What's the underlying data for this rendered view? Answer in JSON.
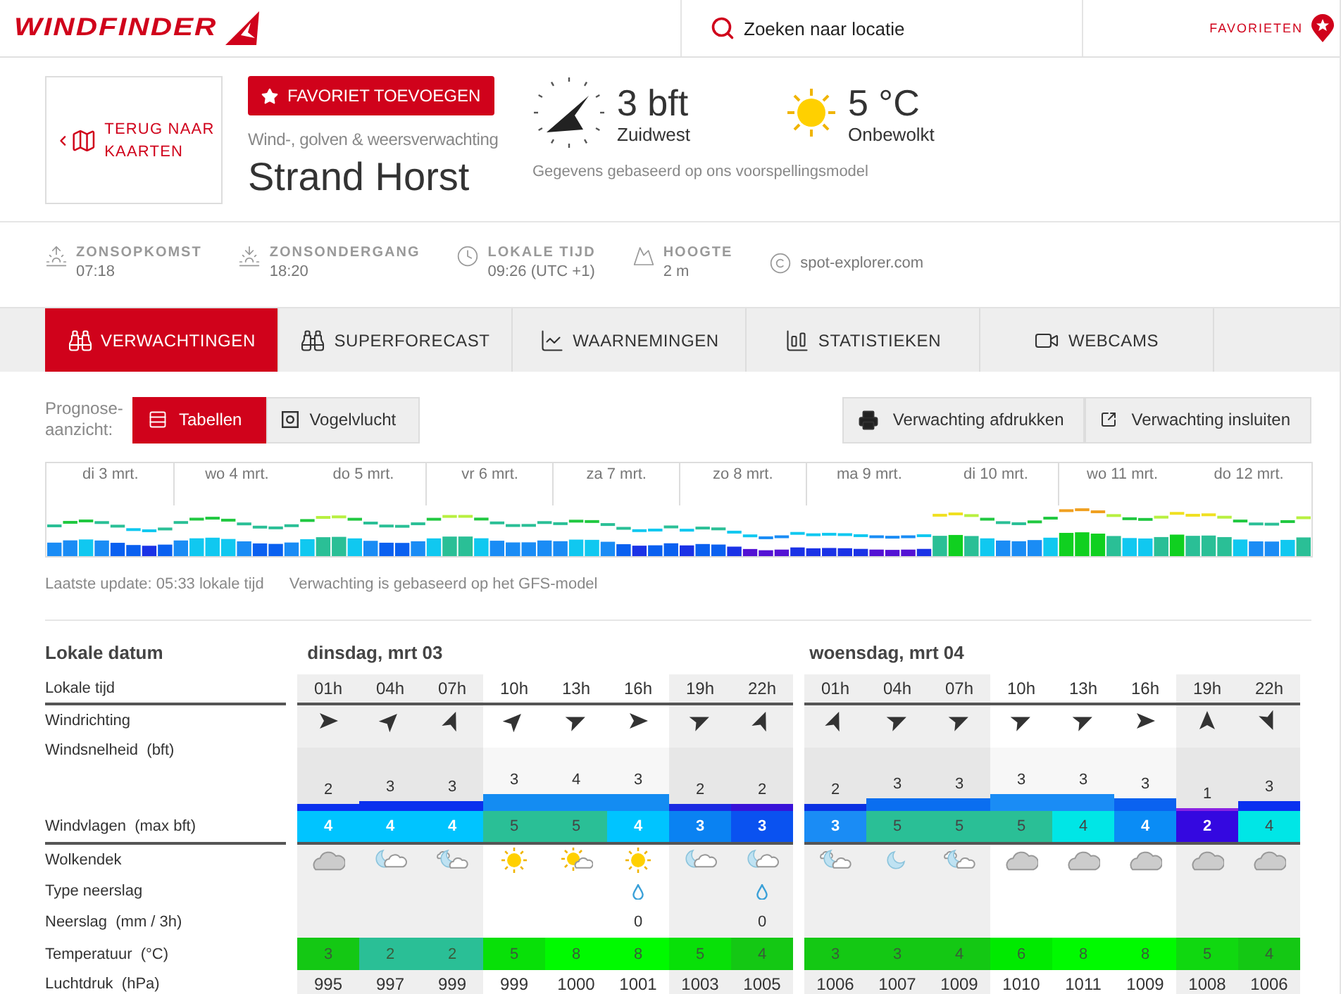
{
  "header": {
    "logo": "WINDFINDER",
    "search": {
      "placeholder": "Zoeken naar locatie"
    },
    "favorites_link": "FAVORIETEN"
  },
  "spot": {
    "back_link": "TERUG NAAR KAARTEN",
    "favorite_button": "FAVORIET TOEVOEGEN",
    "subtitle": "Wind-, golven & weersverwachting",
    "name": "Strand Horst",
    "wind": {
      "value": "3 bft",
      "direction": "Zuidwest"
    },
    "weather": {
      "value": "5 °C",
      "condition": "Onbewolkt"
    },
    "note": "Gegevens gebaseerd op ons voorspellingsmodel"
  },
  "facts": [
    {
      "kind": "sunrise",
      "label": "ZONSOPKOMST",
      "value": "07:18"
    },
    {
      "kind": "sunset",
      "label": "ZONSONDERGANG",
      "value": "18:20"
    },
    {
      "kind": "clock",
      "label": "LOKALE TIJD",
      "value": "09:26 (UTC +1)"
    },
    {
      "kind": "altitude",
      "label": "HOOGTE",
      "value": "2 m"
    },
    {
      "kind": "source",
      "value": "spot-explorer.com"
    }
  ],
  "tabs": [
    {
      "kind": "forecast",
      "label": "VERWACHTINGEN",
      "selected": true
    },
    {
      "kind": "superforecast",
      "label": "SUPERFORECAST",
      "selected": false
    },
    {
      "kind": "observations",
      "label": "WAARNEMINGEN",
      "selected": false
    },
    {
      "kind": "statistics",
      "label": "STATISTIEKEN",
      "selected": false
    },
    {
      "kind": "webcams",
      "label": "WEBCAMS",
      "selected": false
    }
  ],
  "view_switch": {
    "label": "Prognose-aanzicht:",
    "options": [
      {
        "kind": "tables",
        "label": "Tabellen",
        "selected": true
      },
      {
        "kind": "aerial",
        "label": "Vogelvlucht",
        "selected": false
      }
    ]
  },
  "actions": [
    {
      "kind": "print",
      "label": "Verwachting afdrukken"
    },
    {
      "kind": "embed",
      "label": "Verwachting insluiten"
    }
  ],
  "overview": {
    "days": [
      "di 3 mrt.",
      "wo 4 mrt.",
      "do 5 mrt.",
      "vr 6 mrt.",
      "za 7 mrt.",
      "zo 8 mrt.",
      "ma 9 mrt.",
      "di 10 mrt.",
      "wo 11 mrt.",
      "do 12 mrt."
    ]
  },
  "update_info": [
    "Laatste update: 05:33 lokale tijd",
    "Verwachting is gebaseerd op het GFS-model"
  ],
  "table": {
    "date_label": "Lokale datum",
    "rows": [
      {
        "kind": "time",
        "label": "Lokale tijd"
      },
      {
        "kind": "direction",
        "label": "Windrichting"
      },
      {
        "kind": "speed",
        "label": "Windsnelheid  (bft)"
      },
      {
        "kind": "gust",
        "label": "Windvlagen  (max bft)"
      },
      {
        "kind": "cloud",
        "label": "Wolkendek"
      },
      {
        "kind": "precip_type",
        "label": "Type neerslag"
      },
      {
        "kind": "precip",
        "label": "Neerslag  (mm / 3h)"
      },
      {
        "kind": "temp",
        "label": "Temperatuur  (°C)"
      },
      {
        "kind": "pressure",
        "label": "Luchtdruk  (hPa)"
      }
    ],
    "days": [
      {
        "date": "dinsdag, mrt 03",
        "hours": [
          {
            "time": "01h",
            "night": true,
            "arrow": {
              "kind": "E"
            },
            "speed": {
              "value": "2",
              "level": 0.11,
              "color": "#0a30ee"
            },
            "gust": {
              "value": "4",
              "color": "#00c4ff"
            },
            "sky": {
              "kind": "overcast"
            },
            "temp": {
              "value": "3",
              "color": "#14c814"
            },
            "pressure": "995"
          },
          {
            "time": "04h",
            "night": true,
            "arrow": {
              "kind": "NE"
            },
            "speed": {
              "value": "3",
              "level": 0.16,
              "color": "#0a30ee"
            },
            "gust": {
              "value": "4",
              "color": "#00c4ff"
            },
            "sky": {
              "kind": "moon-cloud"
            },
            "temp": {
              "value": "2",
              "color": "#2abf96"
            },
            "pressure": "997"
          },
          {
            "time": "07h",
            "night": true,
            "arrow": {
              "kind": "NNE"
            },
            "speed": {
              "value": "3",
              "level": 0.16,
              "color": "#0a30ee"
            },
            "gust": {
              "value": "4",
              "color": "#00c4ff"
            },
            "sky": {
              "kind": "moon-clouds"
            },
            "temp": {
              "value": "2",
              "color": "#2abf96"
            },
            "pressure": "999"
          },
          {
            "time": "10h",
            "night": false,
            "arrow": {
              "kind": "NE"
            },
            "speed": {
              "value": "3",
              "level": 0.27,
              "color": "#148cf2"
            },
            "gust": {
              "value": "5",
              "color": "#2abf96"
            },
            "sky": {
              "kind": "sun"
            },
            "temp": {
              "value": "5",
              "color": "#08e008"
            },
            "pressure": "999"
          },
          {
            "time": "13h",
            "night": false,
            "arrow": {
              "kind": "ENE"
            },
            "speed": {
              "value": "4",
              "level": 0.27,
              "color": "#148cf2"
            },
            "gust": {
              "value": "5",
              "color": "#2abf96"
            },
            "sky": {
              "kind": "sun-cloud"
            },
            "temp": {
              "value": "8",
              "color": "#00fa00"
            },
            "pressure": "1000"
          },
          {
            "time": "16h",
            "night": false,
            "arrow": {
              "kind": "E"
            },
            "speed": {
              "value": "3",
              "level": 0.27,
              "color": "#148cf2"
            },
            "gust": {
              "value": "4",
              "color": "#00c4ff"
            },
            "sky": {
              "kind": "sun"
            },
            "precip": {
              "kind": "rain",
              "value": "0"
            },
            "temp": {
              "value": "8",
              "color": "#00fa00"
            },
            "pressure": "1001"
          },
          {
            "time": "19h",
            "night": true,
            "arrow": {
              "kind": "ENE"
            },
            "speed": {
              "value": "2",
              "level": 0.11,
              "color": "#1a2ae2"
            },
            "gust": {
              "value": "3",
              "color": "#0a82f2"
            },
            "sky": {
              "kind": "moon-cloud"
            },
            "temp": {
              "value": "5",
              "color": "#08e008"
            },
            "pressure": "1003"
          },
          {
            "time": "22h",
            "night": true,
            "arrow": {
              "kind": "NNE"
            },
            "speed": {
              "value": "2",
              "level": 0.11,
              "color": "#3812d8"
            },
            "gust": {
              "value": "3",
              "color": "#0a52f0"
            },
            "sky": {
              "kind": "moon-cloud"
            },
            "precip": {
              "kind": "rain",
              "value": "0"
            },
            "temp": {
              "value": "4",
              "color": "#14c814"
            },
            "pressure": "1005"
          }
        ]
      },
      {
        "date": "woensdag, mrt 04",
        "hours": [
          {
            "time": "01h",
            "night": true,
            "arrow": {
              "kind": "NNE"
            },
            "speed": {
              "value": "2",
              "level": 0.11,
              "color": "#0a30e2"
            },
            "gust": {
              "value": "3",
              "color": "#1a8cf5"
            },
            "sky": {
              "kind": "moon-clouds"
            },
            "temp": {
              "value": "3",
              "color": "#14c814"
            },
            "pressure": "1006"
          },
          {
            "time": "04h",
            "night": true,
            "arrow": {
              "kind": "ENE"
            },
            "speed": {
              "value": "3",
              "level": 0.2,
              "color": "#0a6ef0"
            },
            "gust": {
              "value": "5",
              "color": "#2abf96"
            },
            "sky": {
              "kind": "moon"
            },
            "temp": {
              "value": "3",
              "color": "#14c814"
            },
            "pressure": "1007"
          },
          {
            "time": "07h",
            "night": true,
            "arrow": {
              "kind": "ENE"
            },
            "speed": {
              "value": "3",
              "level": 0.2,
              "color": "#0a6ef0"
            },
            "gust": {
              "value": "5",
              "color": "#2abf96"
            },
            "sky": {
              "kind": "moon-clouds"
            },
            "temp": {
              "value": "4",
              "color": "#14c814"
            },
            "pressure": "1009"
          },
          {
            "time": "10h",
            "night": false,
            "arrow": {
              "kind": "ENE"
            },
            "speed": {
              "value": "3",
              "level": 0.27,
              "color": "#1a8cf5"
            },
            "gust": {
              "value": "5",
              "color": "#2abf96"
            },
            "sky": {
              "kind": "overcast"
            },
            "temp": {
              "value": "6",
              "color": "#00ea00"
            },
            "pressure": "1010"
          },
          {
            "time": "13h",
            "night": false,
            "arrow": {
              "kind": "ENE"
            },
            "speed": {
              "value": "3",
              "level": 0.27,
              "color": "#1a8cf5"
            },
            "gust": {
              "value": "4",
              "color": "#00e6e6"
            },
            "sky": {
              "kind": "overcast"
            },
            "temp": {
              "value": "8",
              "color": "#00fa00"
            },
            "pressure": "1011"
          },
          {
            "time": "16h",
            "night": false,
            "arrow": {
              "kind": "E"
            },
            "speed": {
              "value": "3",
              "level": 0.2,
              "color": "#0a62f0"
            },
            "gust": {
              "value": "4",
              "color": "#0a8cf5"
            },
            "sky": {
              "kind": "overcast"
            },
            "temp": {
              "value": "8",
              "color": "#00fa00"
            },
            "pressure": "1009"
          },
          {
            "time": "19h",
            "night": true,
            "arrow": {
              "kind": "N"
            },
            "speed": {
              "value": "1",
              "level": 0.04,
              "color": "#8a22e2"
            },
            "gust": {
              "value": "2",
              "color": "#3408e0"
            },
            "sky": {
              "kind": "overcast"
            },
            "temp": {
              "value": "5",
              "color": "#10d810"
            },
            "pressure": "1008"
          },
          {
            "time": "22h",
            "night": true,
            "arrow": {
              "kind": "SSE"
            },
            "speed": {
              "value": "3",
              "level": 0.16,
              "color": "#0a30f0"
            },
            "gust": {
              "value": "4",
              "color": "#00e6e6"
            },
            "sky": {
              "kind": "overcast"
            },
            "temp": {
              "value": "4",
              "color": "#14c814"
            },
            "pressure": "1006"
          }
        ]
      }
    ]
  }
}
